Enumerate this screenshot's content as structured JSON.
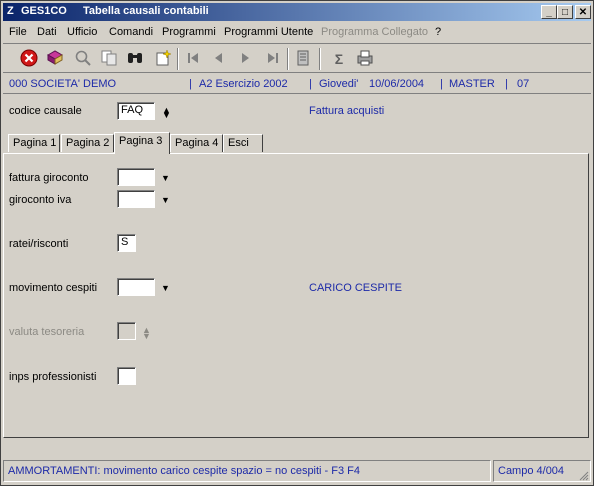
{
  "window": {
    "logo": "Z",
    "app_name": "GES1CO",
    "title": "Tabella causali contabili",
    "buttons": {
      "minimize": "_",
      "maximize": "□",
      "close": "✕"
    }
  },
  "menu": {
    "file": "File",
    "dati": "Dati",
    "ufficio": "Ufficio",
    "comandi": "Comandi",
    "programmi": "Programmi",
    "programmi_utente": "Programmi Utente",
    "programma_collegato": "Programma Collegato",
    "help": "?"
  },
  "toolbar_icons": [
    "close-icon",
    "book-icon",
    "search-icon",
    "copy-icon",
    "binoculars-icon",
    "new-icon",
    "first-icon",
    "prev-icon",
    "next-icon",
    "last-icon",
    "delete-icon",
    "sum-icon",
    "print-icon"
  ],
  "info": {
    "company": "000 SOCIETA' DEMO",
    "exercise": "A2 Esercizio 2002",
    "day": "Giovedi'",
    "date": "10/06/2004",
    "user": "MASTER",
    "code": "07"
  },
  "header_form": {
    "codice_causale_label": "codice causale",
    "codice_causale_value": "FAQ",
    "description": "Fattura acquisti"
  },
  "tabs": [
    {
      "label": "Pagina 1"
    },
    {
      "label": "Pagina 2"
    },
    {
      "label": "Pagina 3"
    },
    {
      "label": "Pagina 4"
    },
    {
      "label": "Esci"
    }
  ],
  "active_tab": 2,
  "fields": {
    "fattura_giroconto": {
      "label": "fattura giroconto",
      "value": ""
    },
    "giroconto_iva": {
      "label": "giroconto iva",
      "value": ""
    },
    "ratei_risconti": {
      "label": "ratei/risconti",
      "value": "S"
    },
    "movimento_cespiti": {
      "label": "movimento cespiti",
      "value": "",
      "description": "CARICO CESPITE"
    },
    "valuta_tesoreria": {
      "label": "valuta tesoreria",
      "value": ""
    },
    "inps_professionisti": {
      "label": "inps professionisti",
      "value": ""
    }
  },
  "status": {
    "message": "AMMORTAMENTI: movimento carico cespite   spazio = no cespiti - F3 F4",
    "campo": "Campo  4/004"
  },
  "colors": {
    "accent": "#1d2aa8",
    "title_start": "#0a246a",
    "title_end": "#a6caf0"
  }
}
